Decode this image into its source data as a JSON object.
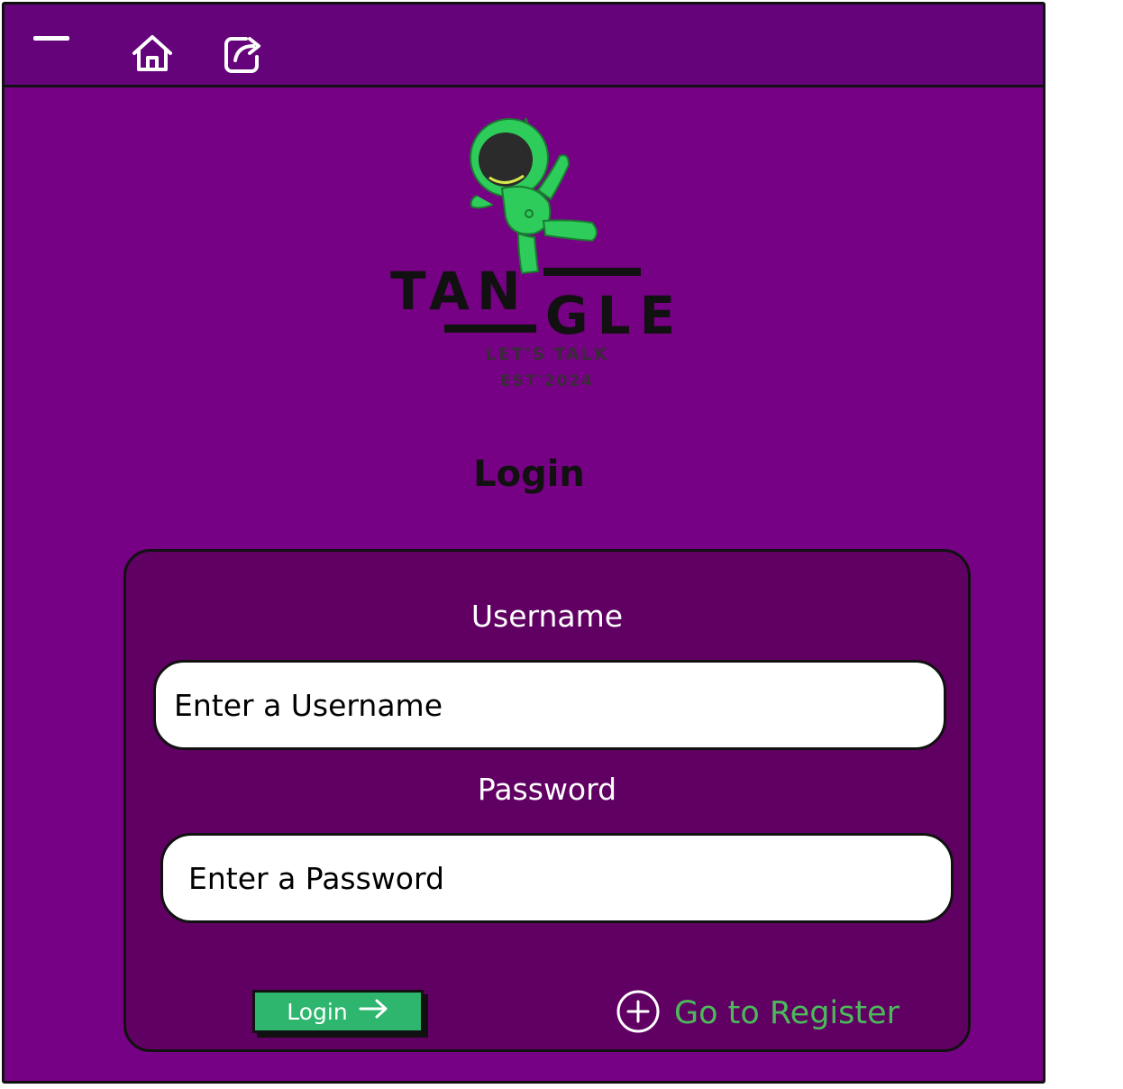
{
  "topbar": {
    "minimize_icon": "minimize-icon",
    "home_icon": "home-icon",
    "share_icon": "share-icon"
  },
  "logo": {
    "brand": "TANGLE",
    "tagline": "LET'S TALK",
    "est": "EST'2024",
    "mascot": "astronaut-mascot"
  },
  "page": {
    "title": "Login"
  },
  "form": {
    "username_label": "Username",
    "username_placeholder": "Enter a Username",
    "password_label": "Password",
    "password_placeholder": "Enter a Password",
    "login_button": "Login",
    "register_link": "Go to Register"
  },
  "colors": {
    "window_bg": "#770184",
    "topbar_bg": "#64037a",
    "panel_bg": "#610063",
    "login_button": "#2eb66f",
    "register_text": "#4cba5b",
    "mascot_green": "#2ecc5a"
  }
}
